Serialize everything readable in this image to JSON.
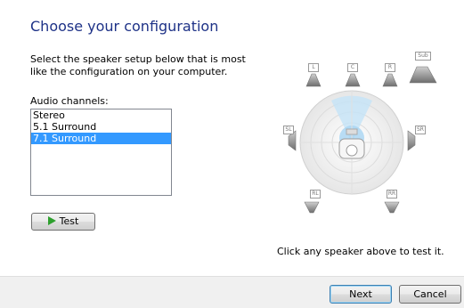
{
  "heading": "Choose your configuration",
  "description": "Select the speaker setup below that is most like the configuration on your computer.",
  "channels_label": "Audio channels:",
  "channels": [
    {
      "label": "Stereo",
      "selected": false
    },
    {
      "label": "5.1 Surround",
      "selected": false
    },
    {
      "label": "7.1 Surround",
      "selected": true
    }
  ],
  "test_button": "Test",
  "speakers": {
    "left": "L",
    "center": "C",
    "right": "R",
    "sub": "Sub",
    "side_left": "SL",
    "side_right": "SR",
    "rear_left": "RL",
    "rear_right": "RR"
  },
  "click_hint": "Click any speaker above to test it.",
  "buttons": {
    "next": "Next",
    "cancel": "Cancel"
  },
  "colors": {
    "heading": "#1e3287",
    "selection": "#3399ff",
    "test_icon": "#2ea02e"
  },
  "icons": {
    "test": "play-icon"
  }
}
